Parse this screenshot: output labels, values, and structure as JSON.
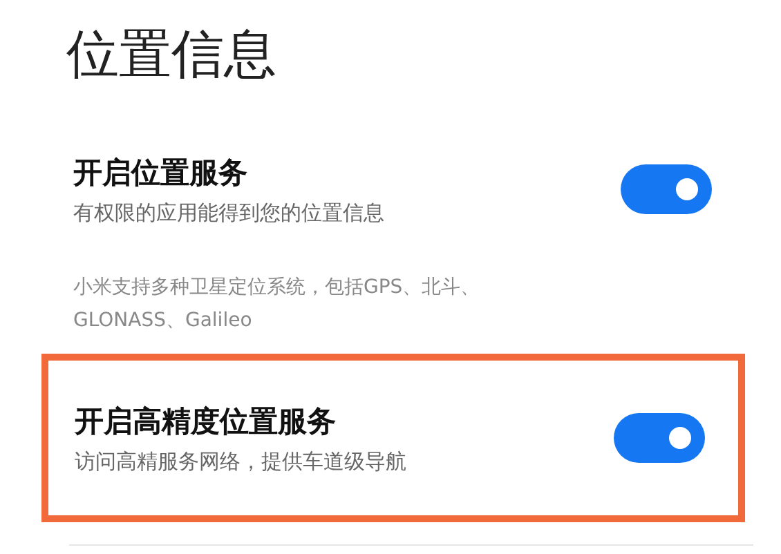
{
  "title": "位置信息",
  "items": [
    {
      "kind": "toggle",
      "label": "开启位置服务",
      "description": "有权限的应用能得到您的位置信息",
      "on": true,
      "highlighted": false
    },
    {
      "kind": "note",
      "lines": [
        "小米支持多种卫星定位系统，包括GPS、北斗、",
        "GLONASS、Galileo"
      ]
    },
    {
      "kind": "toggle",
      "label": "开启高精度位置服务",
      "description": "访问高精服务网络，提供车道级导航",
      "on": true,
      "highlighted": true
    }
  ]
}
